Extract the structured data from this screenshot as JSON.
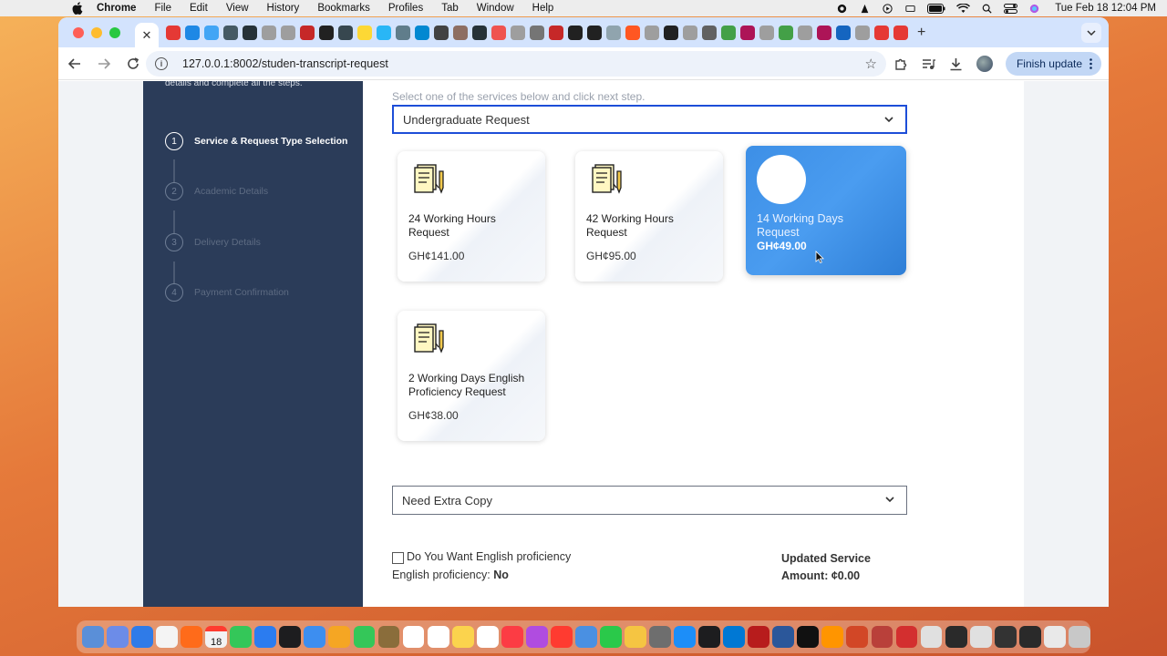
{
  "menubar": {
    "app_name": "Chrome",
    "items": [
      "File",
      "Edit",
      "View",
      "History",
      "Bookmarks",
      "Profiles",
      "Tab",
      "Window",
      "Help"
    ],
    "clock": "Tue Feb 18  12:04 PM"
  },
  "browser": {
    "active_tab_close": "✕",
    "new_tab": "+",
    "url": "127.0.0.1:8002/studen-transcript-request",
    "finish_update_label": "Finish update",
    "favicon_colors": [
      "#e53935",
      "#1e88e5",
      "#42a5f5",
      "#455a64",
      "#263238",
      "#9e9e9e",
      "#9e9e9e",
      "#c62828",
      "#212121",
      "#37474f",
      "#fdd835",
      "#29b6f6",
      "#607d8b",
      "#0288d1",
      "#424242",
      "#8d6e63",
      "#263238",
      "#ef5350",
      "#9e9e9e",
      "#757575",
      "#c62828",
      "#212121",
      "#212121",
      "#90a4ae",
      "#ff5722",
      "#9e9e9e",
      "#212121",
      "#9e9e9e",
      "#616161",
      "#43a047",
      "#ad1457",
      "#9e9e9e",
      "#43a047",
      "#9e9e9e",
      "#ad1457",
      "#1565c0",
      "#9e9e9e",
      "#e53935",
      "#e53935"
    ]
  },
  "page": {
    "stepper_intro": "details and complete all the steps.",
    "steps": [
      {
        "num": "1",
        "label": "Service & Request Type Selection",
        "active": true
      },
      {
        "num": "2",
        "label": "Academic Details",
        "active": false
      },
      {
        "num": "3",
        "label": "Delivery Details",
        "active": false
      },
      {
        "num": "4",
        "label": "Payment Confirmation",
        "active": false
      }
    ],
    "hint": "Select one of the services below and click next step.",
    "request_type_select": "Undergraduate Request",
    "cards": [
      {
        "title": "24 Working Hours Request",
        "price": "GH¢141.00"
      },
      {
        "title": "42 Working Hours Request",
        "price": "GH¢95.00"
      },
      {
        "title": "14 Working Days Request",
        "price": "GH¢49.00",
        "selected": true
      },
      {
        "title": "2 Working Days English Proficiency Request",
        "price": "GH¢38.00"
      }
    ],
    "extra_copy_select": "Need Extra Copy",
    "english_checkbox_label": "Do You Want English proficiency",
    "english_prof_label": "English proficiency:",
    "english_prof_value": "No",
    "updated_service_label": "Updated Service",
    "amount_label": "Amount: ¢0.00"
  },
  "dock": {
    "calendar_day": "18",
    "icon_colors": [
      "#5a8fd8",
      "#6c8ce8",
      "#2f7be8",
      "#f4f4f4",
      "#ff6b1a",
      "#f2f2f2",
      "#34c759",
      "#2b7cf0",
      "#1d1d1f",
      "#3d8ef0",
      "#f5a623",
      "#34c759",
      "#8a6d3b",
      "#ffffff",
      "#fff",
      "#fbd34d",
      "#ffffff",
      "#fc3c44",
      "#b04ce0",
      "#ff3b30",
      "#4a90e2",
      "#2ac94a",
      "#f5c542",
      "#6e6e6e",
      "#1c8ef9",
      "#1d1d1f",
      "#0078d4",
      "#b71c1c",
      "#2b579a",
      "#111111",
      "#ff9500",
      "#d24726",
      "#b9403a",
      "#d32f2f",
      "#e0e0e0",
      "#2a2a2a",
      "#e0e0e0",
      "#333333",
      "#2a2a2a",
      "#e9e9e9",
      "#c8c8c8"
    ]
  }
}
